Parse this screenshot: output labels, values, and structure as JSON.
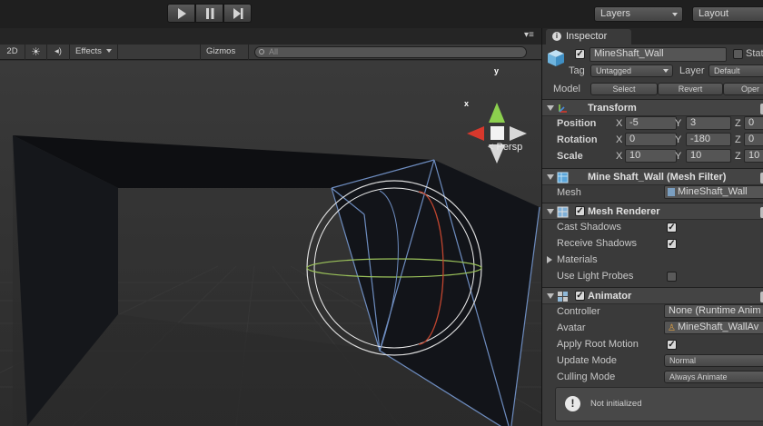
{
  "toolbar": {
    "layers_label": "Layers",
    "layout_label": "Layout",
    "play_icon": "play-icon",
    "pause_icon": "pause-icon",
    "step_icon": "step-icon"
  },
  "scene": {
    "btn_2d": "2D",
    "btn_effects": "Effects",
    "btn_gizmos": "Gizmos",
    "search_placeholder": "All",
    "persp_label": "< Persp",
    "axis_x": "x",
    "axis_y": "y"
  },
  "inspector": {
    "tab_label": "Inspector",
    "object_name": "MineShaft_Wall",
    "static_label": "Stat",
    "tag_label": "Tag",
    "tag_value": "Untagged",
    "layer_label": "Layer",
    "layer_value": "Default",
    "model_label": "Model",
    "model_buttons": [
      "Select",
      "Revert",
      "Oper"
    ],
    "transform": {
      "title": "Transform",
      "position_label": "Position",
      "rotation_label": "Rotation",
      "scale_label": "Scale",
      "position": {
        "x": "-5",
        "y": "3",
        "z": "0"
      },
      "rotation": {
        "x": "0",
        "y": "-180",
        "z": "0"
      },
      "scale": {
        "x": "10",
        "y": "10",
        "z": "10"
      }
    },
    "mesh_filter": {
      "title": "Mine Shaft_Wall (Mesh Filter)",
      "mesh_label": "Mesh",
      "mesh_value": "MineShaft_Wall"
    },
    "mesh_renderer": {
      "title": "Mesh Renderer",
      "cast_shadows_label": "Cast Shadows",
      "receive_shadows_label": "Receive Shadows",
      "materials_label": "Materials",
      "use_light_probes_label": "Use Light Probes",
      "cast_shadows": true,
      "receive_shadows": true,
      "use_light_probes": false
    },
    "animator": {
      "title": "Animator",
      "controller_label": "Controller",
      "controller_value": "None (Runtime Anim",
      "avatar_label": "Avatar",
      "avatar_value": "MineShaft_WallAv",
      "apply_root_motion_label": "Apply Root Motion",
      "update_mode_label": "Update Mode",
      "update_mode_value": "Normal",
      "culling_mode_label": "Culling Mode",
      "culling_mode_value": "Always Animate",
      "apply_root_motion": true,
      "notice": "Not initialized"
    }
  }
}
